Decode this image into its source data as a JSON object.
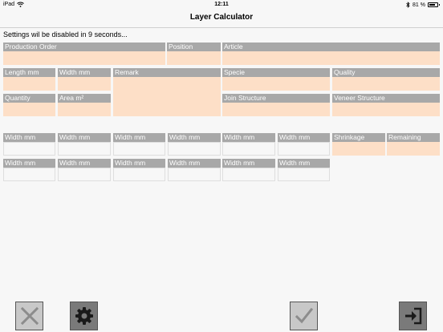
{
  "statusbar": {
    "device": "iPad",
    "time": "12:11",
    "battery_text": "81 %",
    "battery_level": 0.81
  },
  "nav": {
    "title": "Layer Calculator"
  },
  "message": "Settings wil be disabled in 9 seconds...",
  "fields": {
    "production_order": "Production Order",
    "position": "Position",
    "article": "Article",
    "length": "Length mm",
    "width": "Width mm",
    "remark": "Remark",
    "specie": "Specie",
    "quality": "Quality",
    "quantity": "Quantity",
    "area": "Area m²",
    "join_structure": "Join Structure",
    "veneer_structure": "Veneer Structure",
    "shrinkage": "Shrinkage",
    "remaining": "Remaining"
  },
  "layer_rows": [
    [
      "Width mm",
      "Width mm",
      "Width mm",
      "Width mm",
      "Width mm",
      "Width mm"
    ],
    [
      "Width mm",
      "Width mm",
      "Width mm",
      "Width mm",
      "Width mm",
      "Width mm"
    ]
  ],
  "toolbar": {
    "cancel_icon": "close-icon",
    "settings_icon": "gear-icon",
    "confirm_icon": "check-icon",
    "exit_icon": "sign-in-icon"
  },
  "colors": {
    "label_bg": "#a8a8a8",
    "field_peach": "#fddfc7",
    "background": "#f7f7f7"
  }
}
